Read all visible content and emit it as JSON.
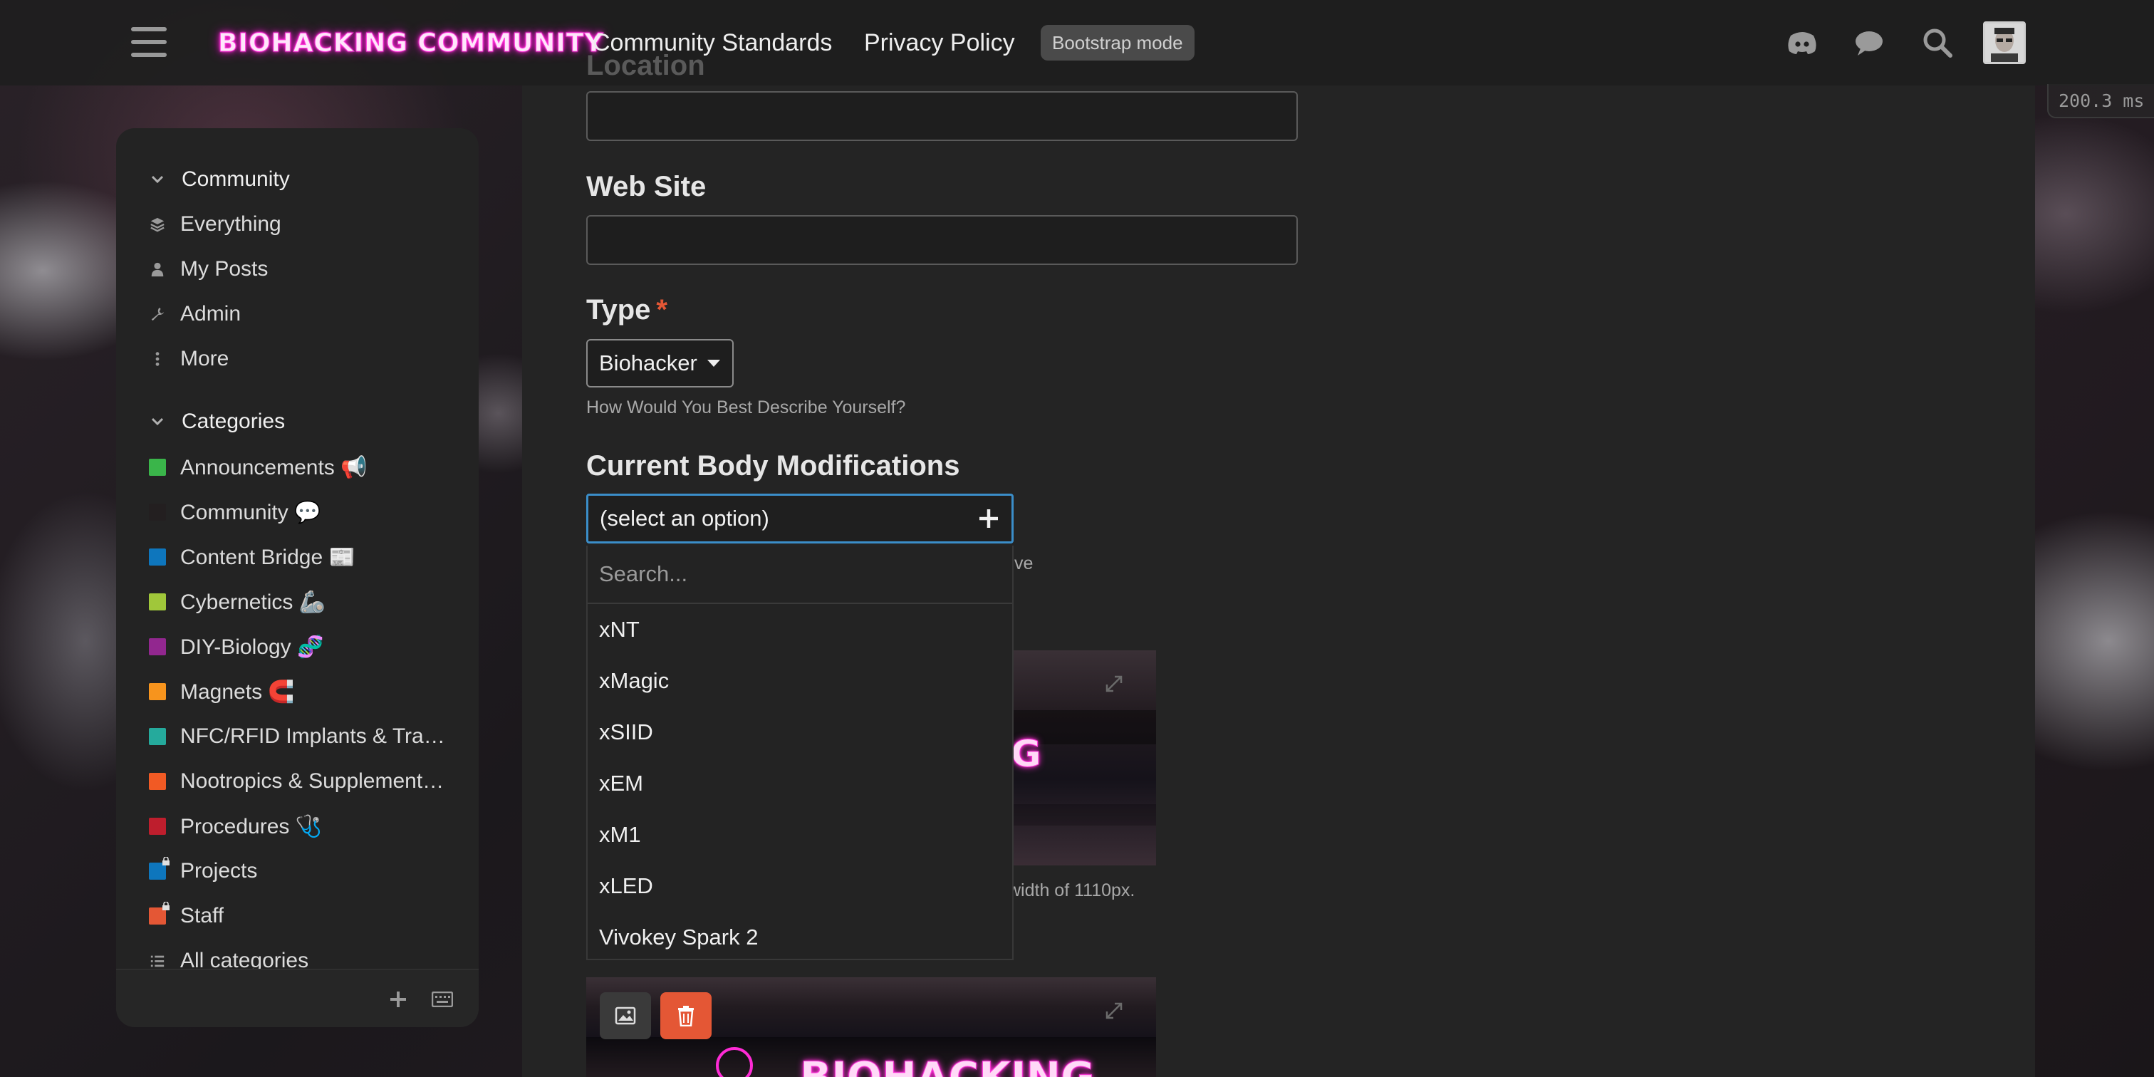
{
  "header": {
    "logo_text": "BIOHACKING COMMUNITY",
    "nav": [
      {
        "label": "Community Standards"
      },
      {
        "label": "Privacy Policy"
      }
    ],
    "bootstrap_badge": "Bootstrap mode",
    "icons": [
      "discord-icon",
      "chat-icon",
      "search-icon"
    ],
    "timing": "200.3 ms"
  },
  "sidebar": {
    "community": {
      "title": "Community",
      "items": [
        {
          "label": "Everything",
          "icon": "layers-icon"
        },
        {
          "label": "My Posts",
          "icon": "user-icon"
        },
        {
          "label": "Admin",
          "icon": "wrench-icon"
        },
        {
          "label": "More",
          "icon": "ellipsis-vertical-icon"
        }
      ]
    },
    "categories": {
      "title": "Categories",
      "items": [
        {
          "label": "Announcements 📢",
          "color": "#3ab54a"
        },
        {
          "label": "Community 💬",
          "color": "#231f20"
        },
        {
          "label": "Content Bridge 📰",
          "color": "#0e76bd"
        },
        {
          "label": "Cybernetics 🦾",
          "color": "#a0c73a"
        },
        {
          "label": "DIY-Biology 🧬",
          "color": "#92278f"
        },
        {
          "label": "Magnets 🧲",
          "color": "#f7941d"
        },
        {
          "label": "NFC/RFID Implants & Tra…",
          "color": "#25aa9c"
        },
        {
          "label": "Nootropics & Supplement…",
          "color": "#f15a24"
        },
        {
          "label": "Procedures 🩺",
          "color": "#be1e2d"
        },
        {
          "label": "Projects",
          "color": "#0e76bd",
          "locked": true
        },
        {
          "label": "Staff",
          "color": "#e45735",
          "locked": true
        },
        {
          "label": "All categories",
          "icon": "list-icon"
        }
      ]
    }
  },
  "form": {
    "location_label": "Location",
    "location_value": "",
    "website_label": "Web Site",
    "website_value": "",
    "type_label": "Type",
    "type_required": "*",
    "type_value": "Biohacker",
    "type_help": "How Would You Best Describe Yourself?",
    "mods_label": "Current Body Modifications",
    "mods_value": "(select an option)",
    "mods_help_fragment": "ve",
    "image_help_fragment": "width of 1110px.",
    "dropdown": {
      "search_placeholder": "Search...",
      "options": [
        "xNT",
        "xMagic",
        "xSIID",
        "xEM",
        "xM1",
        "xLED",
        "Vivokey Spark 2"
      ]
    },
    "logo_fragment_1": "G",
    "logo_fragment_2": "BIOHACKING"
  },
  "colors": {
    "accent_blue": "#3b8ec9",
    "required_red": "#e45735",
    "neon_pink": "#ff2bd6",
    "delete_button": "#e45735"
  }
}
